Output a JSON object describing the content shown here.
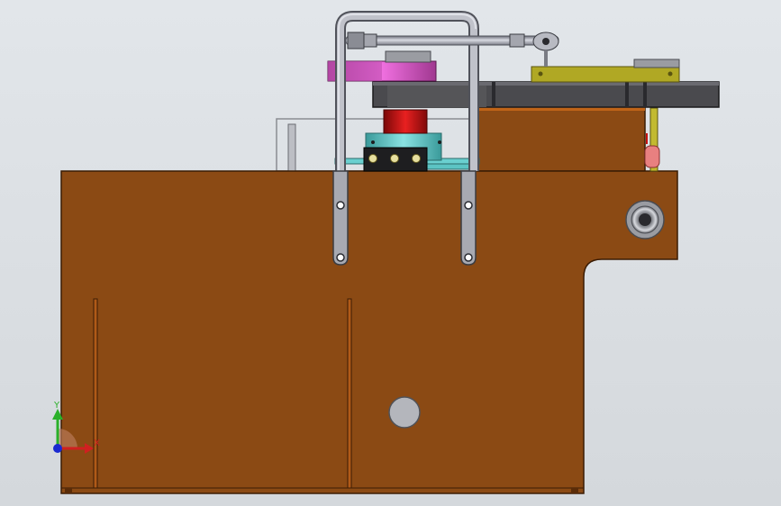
{
  "window": {
    "view": "front"
  },
  "colors": {
    "background_top": "#e2e6ea",
    "background_bottom": "#d4d8dc",
    "frame_body": "#8b4a14",
    "frame_edge": "#3b1c04",
    "steel": "#a8aab0",
    "steel_dark": "#5a5c62",
    "cylinder_red": "#c41010",
    "plate_teal": "#5cc4c4",
    "pulley_magenta": "#d050c0",
    "bar_olive": "#b0a824",
    "beam_dark": "#4a4a4e",
    "hole_gray": "#b4b6bc"
  },
  "triad": {
    "y_label": "Y",
    "x_label": "X",
    "y_color": "#2ab02a",
    "x_color": "#d02020",
    "z_color": "#1a2ad0"
  }
}
